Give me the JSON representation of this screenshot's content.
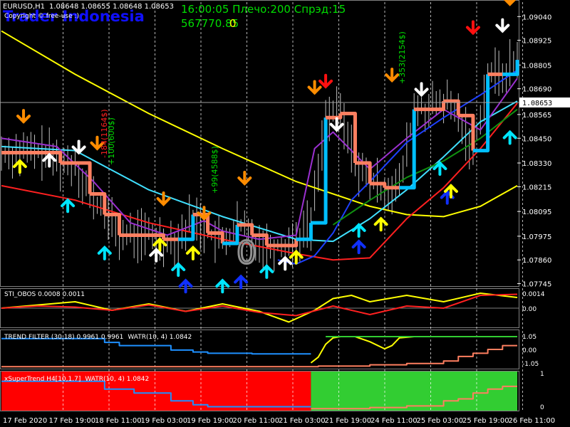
{
  "header": {
    "symbol_info": "EURUSD,H1",
    "ohlc": "1.08648 1.08655 1.08648 1.08653",
    "watermark": "Trader Indonesia",
    "copyright": "Copyright © free-use :)",
    "clock_line": "16:00:05 Плечо:200 Спрэд:15",
    "balance": "567770.85",
    "balance_suffix": "0"
  },
  "colors": {
    "background": "#000000",
    "grid": "#ffffff",
    "candles": "#c0c0c0",
    "salmon_line": "#ff7f60",
    "cyan_line": "#00bfff",
    "ma_yellow": "#ffff00",
    "ma_red": "#ff2020",
    "ma_sky": "#40e0ff",
    "ma_blue": "#1e40ff",
    "ma_purple": "#9b30d0",
    "ma_green": "#109010",
    "arrow_orange": "#ff8c00",
    "arrow_red": "#ff1010",
    "arrow_cyan": "#00e5ff",
    "arrow_blue": "#1030ff",
    "arrow_yellow": "#ffff00",
    "arrow_white": "#ffffff",
    "green_text": "#00dd00",
    "zone_red": "#ff0000",
    "zone_green": "#32cd32"
  },
  "chart_data": [
    {
      "type": "line",
      "title": "EURUSD,H1",
      "x_tick_labels": [
        "17 Feb 2020",
        "17 Feb 19:00",
        "18 Feb 11:00",
        "19 Feb 03:00",
        "19 Feb 19:00",
        "20 Feb 11:00",
        "21 Feb 03:00",
        "21 Feb 19:00",
        "24 Feb 11:00",
        "25 Feb 03:00",
        "25 Feb 19:00",
        "26 Feb 11:00"
      ],
      "y_tick_labels": [
        "1.09040",
        "1.08925",
        "1.08805",
        "1.08690",
        "1.08565",
        "1.08450",
        "1.08330",
        "1.08215",
        "1.08095",
        "1.07975",
        "1.07860",
        "1.07745"
      ],
      "ylim": [
        1.0774,
        1.0911
      ],
      "current_price": "1.08653",
      "annotations": [
        "-184(1164$)",
        "+100(600$)",
        "+99(4588$)",
        "+353(2154$)",
        "0"
      ],
      "series": [
        {
          "kind": "trend_stepline",
          "x": [
            0,
            4,
            8,
            12,
            16,
            20,
            24,
            28,
            32,
            36,
            40,
            44,
            48,
            52,
            56,
            60,
            64,
            68,
            72,
            76,
            80,
            84,
            88,
            92,
            96,
            100,
            104,
            108,
            112,
            116,
            120,
            124,
            128,
            132,
            136,
            140
          ],
          "y": [
            1.0838,
            1.0838,
            1.0838,
            1.0838,
            1.0833,
            1.0833,
            1.0818,
            1.0808,
            1.0798,
            1.0798,
            1.0798,
            1.0796,
            1.0796,
            1.0808,
            1.0799,
            1.0794,
            1.0803,
            1.0798,
            1.0793,
            1.0793,
            1.0796,
            1.0804,
            1.0855,
            1.0857,
            1.0833,
            1.0823,
            1.0821,
            1.0821,
            1.0859,
            1.0859,
            1.0863,
            1.0856,
            1.0839,
            1.0876,
            1.0876,
            1.0883
          ]
        },
        {
          "kind": "ma_yellow",
          "x": [
            0,
            20,
            40,
            60,
            80,
            100,
            110,
            120,
            130,
            140
          ],
          "y": [
            1.0897,
            1.0876,
            1.0857,
            1.084,
            1.0824,
            1.0812,
            1.0808,
            1.0807,
            1.0812,
            1.0822
          ]
        },
        {
          "kind": "ma_red",
          "x": [
            0,
            20,
            40,
            60,
            80,
            90,
            100,
            110,
            120,
            130,
            140
          ],
          "y": [
            1.0822,
            1.0815,
            1.0804,
            1.0796,
            1.0789,
            1.0786,
            1.0787,
            1.0806,
            1.0821,
            1.084,
            1.0862
          ]
        },
        {
          "kind": "ma_sky",
          "x": [
            0,
            20,
            40,
            60,
            80,
            90,
            100,
            110,
            120,
            130,
            140
          ],
          "y": [
            1.0841,
            1.0839,
            1.082,
            1.0807,
            1.0796,
            1.0795,
            1.0806,
            1.082,
            1.0836,
            1.0853,
            1.0863
          ]
        },
        {
          "kind": "ma_blue",
          "x": [
            75,
            80,
            85,
            90,
            95,
            100,
            110,
            120,
            130,
            140
          ],
          "y": [
            1.0786,
            1.0784,
            1.0788,
            1.0799,
            1.0815,
            1.0824,
            1.0843,
            1.0855,
            1.0866,
            1.0878
          ]
        },
        {
          "kind": "ma_purple",
          "x": [
            0,
            15,
            25,
            35,
            45,
            55,
            60,
            70,
            80,
            85,
            90,
            100,
            110,
            120,
            130,
            140
          ],
          "y": [
            1.0845,
            1.0841,
            1.0824,
            1.0804,
            1.0798,
            1.0805,
            1.08,
            1.0796,
            1.0798,
            1.084,
            1.0848,
            1.083,
            1.0845,
            1.0859,
            1.0849,
            1.0874
          ]
        },
        {
          "kind": "ma_green",
          "x": [
            90,
            100,
            110,
            120,
            130,
            140
          ],
          "y": [
            1.0803,
            1.0815,
            1.0826,
            1.0834,
            1.0845,
            1.0859
          ]
        }
      ]
    },
    {
      "type": "line",
      "title": "STI_OBOS 0.0008 0.0011",
      "y_tick_labels": [
        "0.0014",
        "0.00"
      ],
      "series": [
        {
          "name": "yellow",
          "x": [
            0,
            10,
            20,
            30,
            40,
            50,
            60,
            70,
            78,
            85,
            90,
            95,
            100,
            110,
            120,
            130,
            140
          ],
          "y": [
            0.0,
            0.0003,
            0.0006,
            -0.0002,
            0.0004,
            -0.0003,
            0.0004,
            -0.0003,
            -0.0013,
            -0.0002,
            0.0009,
            0.0012,
            0.0006,
            0.0012,
            0.0006,
            0.0014,
            0.001
          ]
        },
        {
          "name": "red",
          "x": [
            0,
            10,
            20,
            30,
            40,
            50,
            60,
            70,
            80,
            90,
            100,
            110,
            120,
            130,
            140
          ],
          "y": [
            0.0,
            0.0002,
            0.0001,
            -0.0002,
            0.0003,
            -0.0003,
            0.0002,
            -0.0004,
            -0.0007,
            0.0002,
            -0.0006,
            0.0002,
            0.0,
            0.0012,
            0.0013
          ]
        }
      ]
    },
    {
      "type": "line",
      "title": "TREND FILTER (30,18) 0.9961 0.9961",
      "subtitle": "WATR(10, 4) 1.0842",
      "y_tick_labels": [
        "1.05",
        "0.00",
        "-1.05"
      ],
      "series": [
        {
          "name": "yellow",
          "x": [
            84,
            86,
            88,
            90,
            92,
            96,
            100,
            104,
            106,
            108,
            112,
            140
          ],
          "y": [
            -1.05,
            -0.6,
            0.4,
            0.9,
            1.0,
            1.0,
            0.6,
            0.05,
            0.3,
            0.9,
            1.0,
            1.0
          ]
        },
        {
          "name": "green",
          "x": [
            88,
            140
          ],
          "y": [
            1.0,
            1.0
          ]
        },
        {
          "name": "blue_step",
          "x": [
            0,
            20,
            28,
            32,
            40,
            46,
            52,
            56,
            68,
            84
          ],
          "y": [
            0.85,
            0.85,
            0.55,
            0.3,
            0.3,
            -0.05,
            -0.2,
            -0.3,
            -0.35,
            -0.35
          ]
        },
        {
          "name": "orange_step",
          "x": [
            0,
            80,
            86,
            100,
            110,
            120,
            124,
            128,
            132,
            136,
            140
          ],
          "y": [
            -1.35,
            -1.35,
            -1.3,
            -1.2,
            -1.1,
            -0.9,
            -0.55,
            -0.3,
            0.0,
            0.3,
            0.3
          ]
        }
      ]
    },
    {
      "type": "area",
      "title": "xSuperTrend H4[10,1.7]",
      "subtitle": "WATR(10, 4) 1.0842",
      "y_tick_labels": [
        "1",
        "0"
      ],
      "zones": [
        {
          "from": 0,
          "to": 84,
          "color": "red"
        },
        {
          "from": 84,
          "to": 140,
          "color": "green"
        }
      ],
      "series": [
        {
          "name": "blue_step",
          "x": [
            0,
            20,
            28,
            36,
            46,
            52,
            56,
            84
          ],
          "y": [
            0.75,
            0.75,
            0.55,
            0.45,
            0.25,
            0.15,
            0.1,
            0.1
          ]
        },
        {
          "name": "orange_step",
          "x": [
            84,
            100,
            110,
            120,
            124,
            128,
            132,
            136,
            140
          ],
          "y": [
            0.05,
            0.08,
            0.12,
            0.25,
            0.3,
            0.45,
            0.55,
            0.62,
            0.62
          ]
        }
      ]
    }
  ]
}
